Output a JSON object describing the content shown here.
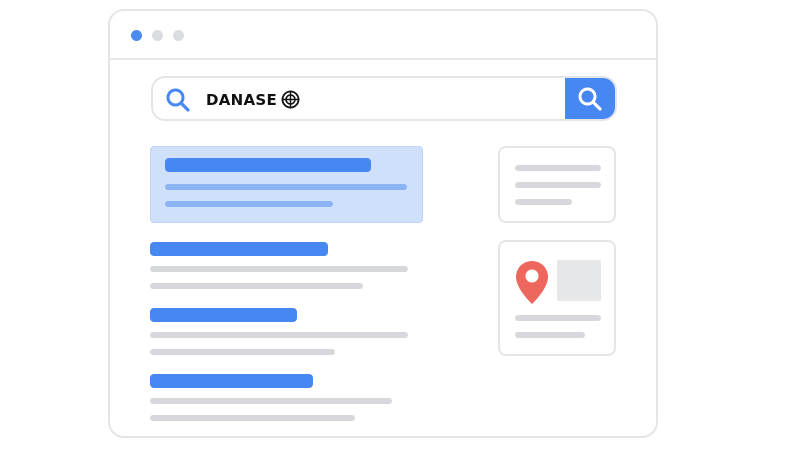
{
  "window": {
    "controls": [
      "close",
      "minimize",
      "maximize"
    ]
  },
  "search": {
    "query": "DANASE",
    "logo_icon": "crosshair-target-icon",
    "leading_icon": "search-icon",
    "button_icon": "search-icon"
  },
  "results": {
    "featured_snippet": true,
    "organic_count": 3
  },
  "side_panel": {
    "cards": [
      "info-card",
      "map-card"
    ],
    "map_icon": "map-pin-icon"
  },
  "colors": {
    "accent": "#4787f2",
    "featured_bg": "#cfe0fb",
    "placeholder_line": "#d7d8db",
    "pin": "#ee675c",
    "window_border": "#e3e5e8"
  }
}
